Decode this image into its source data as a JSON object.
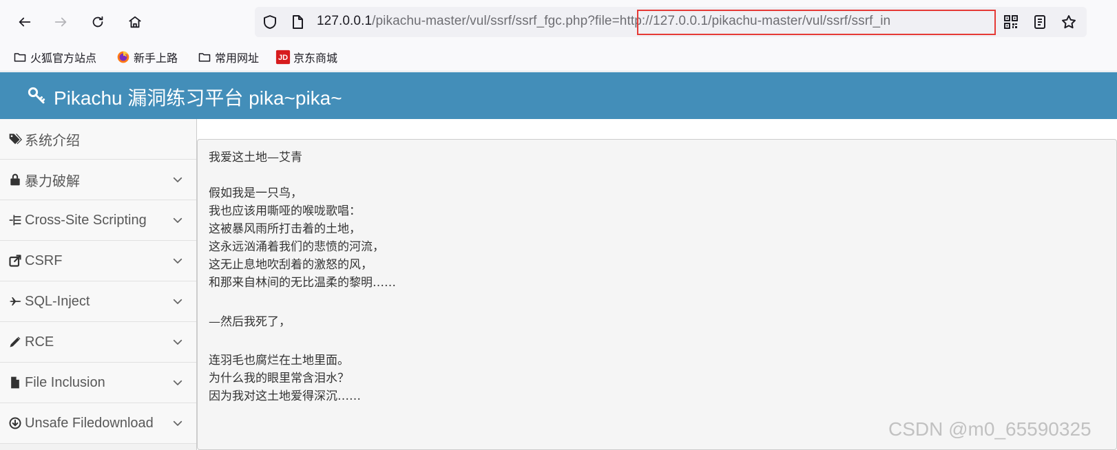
{
  "browser": {
    "url_host": "127.0.0.1",
    "url_path": "/pikachu-master/vul/ssrf/ssrf_fgc.php?",
    "url_query": "file=http://127.0.0.1/pikachu-master/vul/ssrf/ssrf_in",
    "highlight_color": "#e53935",
    "icons": [
      "back-icon",
      "forward-icon",
      "reload-icon",
      "home-icon",
      "shield-icon",
      "page-icon",
      "qr-code-icon",
      "reader-view-icon",
      "star-icon"
    ]
  },
  "bookmarks": [
    {
      "label": "火狐官方站点",
      "icon": "folder-icon"
    },
    {
      "label": "新手上路",
      "icon": "firefox-icon"
    },
    {
      "label": "常用网址",
      "icon": "folder-icon"
    },
    {
      "label": "京东商城",
      "icon": "jd-icon"
    }
  ],
  "site": {
    "title": "Pikachu 漏洞练习平台 pika~pika~",
    "header_color": "#438eb9"
  },
  "sidebar": {
    "items": [
      {
        "label": "系统介绍",
        "icon": "tags-icon",
        "expandable": false
      },
      {
        "label": "暴力破解",
        "icon": "lock-icon",
        "expandable": true
      },
      {
        "label": "Cross-Site Scripting",
        "icon": "list-tree-icon",
        "expandable": true
      },
      {
        "label": "CSRF",
        "icon": "external-link-icon",
        "expandable": true
      },
      {
        "label": "SQL-Inject",
        "icon": "plane-icon",
        "expandable": true
      },
      {
        "label": "RCE",
        "icon": "pencil-icon",
        "expandable": true
      },
      {
        "label": "File Inclusion",
        "icon": "file-icon",
        "expandable": true
      },
      {
        "label": "Unsafe Filedownload",
        "icon": "download-circle-icon",
        "expandable": true
      }
    ]
  },
  "poem": {
    "title": "我爱这土地—艾青",
    "stanza1": [
      "假如我是一只鸟，",
      "我也应该用嘶哑的喉咙歌唱：",
      "这被暴风雨所打击着的土地，",
      "这永远汹涌着我们的悲愤的河流，",
      "这无止息地吹刮着的激怒的风，",
      "和那来自林间的无比温柔的黎明……"
    ],
    "stanza2": [
      "—然后我死了，"
    ],
    "stanza3": [
      "连羽毛也腐烂在土地里面。",
      "为什么我的眼里常含泪水？",
      "因为我对这土地爱得深沉……"
    ]
  },
  "watermark": "CSDN @m0_65590325"
}
